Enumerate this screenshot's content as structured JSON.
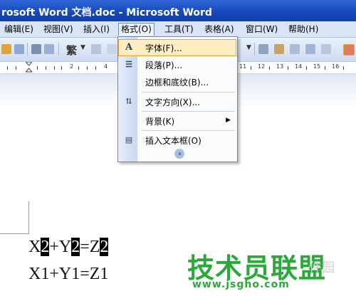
{
  "window": {
    "title": "rosoft Word 文档.doc - Microsoft Word"
  },
  "menubar": {
    "items": [
      {
        "label": "编辑(E)"
      },
      {
        "label": "视图(V)"
      },
      {
        "label": "插入(I)"
      },
      {
        "label": "格式(O)"
      },
      {
        "label": "工具(T)"
      },
      {
        "label": "表格(A)"
      },
      {
        "label": "窗口(W)"
      },
      {
        "label": "帮助(H)"
      }
    ]
  },
  "toolbar": {
    "traditional_label": "繁"
  },
  "ruler": {
    "numbers": [
      "2",
      "4",
      "11",
      "12",
      "13",
      "14",
      "15",
      "16"
    ]
  },
  "format_menu": {
    "items": [
      {
        "label": "字体(F)...",
        "icon": "font-icon"
      },
      {
        "label": "段落(P)...",
        "icon": "paragraph-icon"
      },
      {
        "label": "边框和底纹(B)...",
        "icon": ""
      },
      {
        "label": "文字方向(X)...",
        "icon": "text-direction-icon"
      },
      {
        "label": "背景(K)",
        "icon": "",
        "submenu": true
      },
      {
        "label": "插入文本框(O)",
        "icon": "textbox-icon"
      }
    ],
    "expand_icon": "double-chevron-down-icon"
  },
  "document": {
    "line1": {
      "parts": [
        "X",
        "2",
        "+Y",
        "2",
        "=Z",
        "2"
      ]
    },
    "line2": "X1+Y1=Z1"
  },
  "watermark": {
    "brand": "技术员联盟",
    "url": "www.jsgho.com",
    "faint": "件园"
  }
}
